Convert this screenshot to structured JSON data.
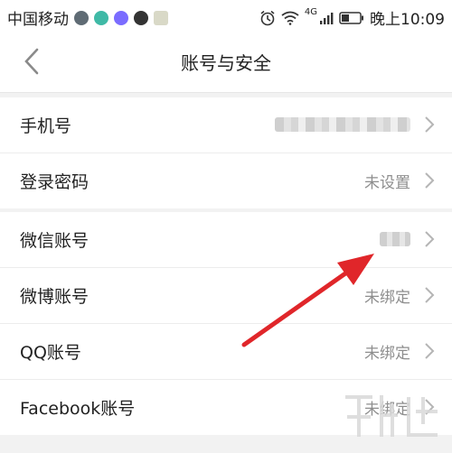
{
  "status_bar": {
    "carrier": "中国移动",
    "network_label": "4G",
    "time": "晚上10:09"
  },
  "header": {
    "title": "账号与安全"
  },
  "groups": [
    {
      "rows": [
        {
          "label": "手机号",
          "value": ""
        },
        {
          "label": "登录密码",
          "value": "未设置"
        }
      ]
    },
    {
      "rows": [
        {
          "label": "微信账号",
          "value": ""
        },
        {
          "label": "微博账号",
          "value": "未绑定"
        },
        {
          "label": "QQ账号",
          "value": "未绑定"
        },
        {
          "label": "Facebook账号",
          "value": "未绑定"
        }
      ]
    }
  ],
  "colors": {
    "annotation_arrow": "#e0262a",
    "value_text": "#8e8e8e",
    "divider": "#ececec"
  },
  "icons": [
    "back-chevron-icon",
    "chevron-right-icon",
    "alarm-icon",
    "wifi-icon",
    "signal-icon",
    "battery-icon"
  ]
}
